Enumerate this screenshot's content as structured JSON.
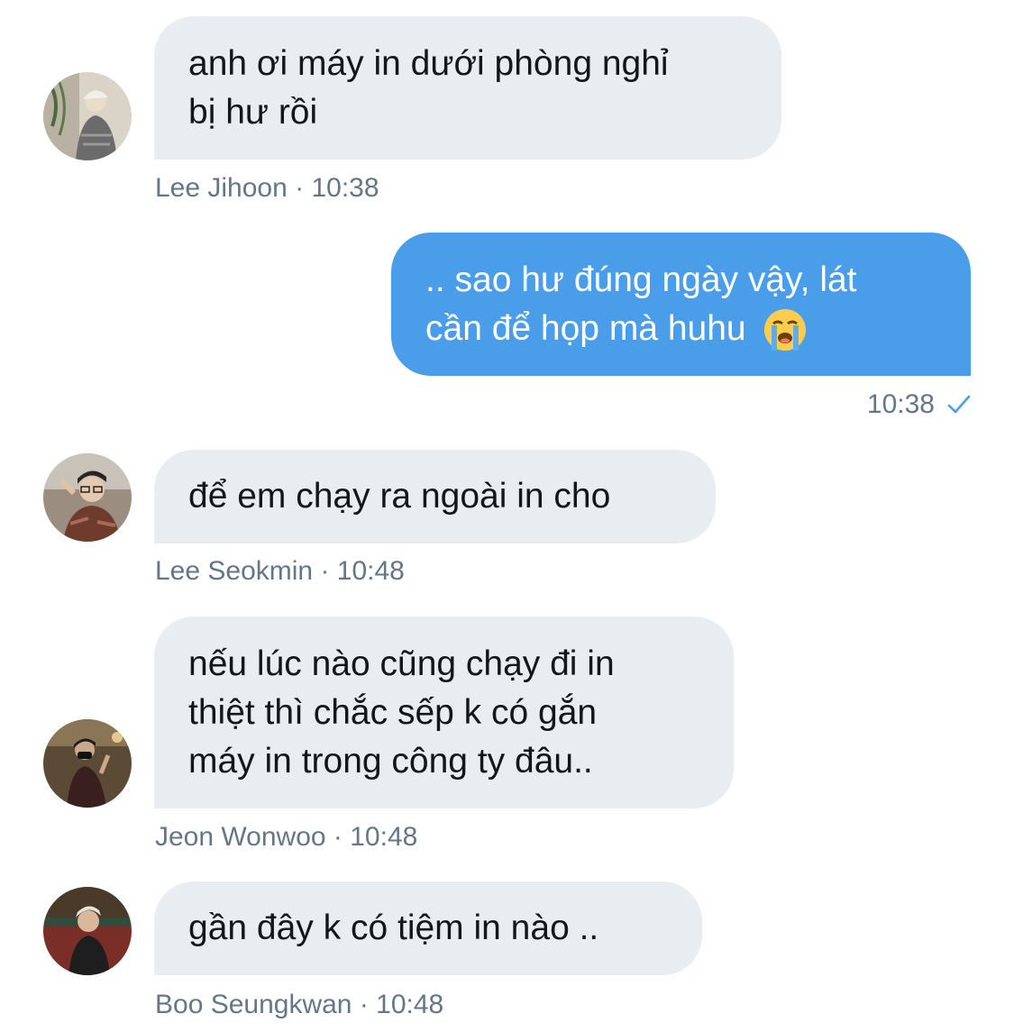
{
  "messages": [
    {
      "direction": "incoming",
      "avatar_icon": "user-avatar-jihoon",
      "text": "anh ơi máy in dưới phòng nghỉ\nbị hư rồi",
      "sender": "Lee Jihoon",
      "time": "10:38"
    },
    {
      "direction": "outgoing",
      "line1": ".. sao hư đúng ngày vậy, lát",
      "line2": "cần để họp mà huhu",
      "emoji_icon": "loudly-crying-face-icon",
      "time": "10:38",
      "status_icon": "read-check-icon"
    },
    {
      "direction": "incoming",
      "avatar_icon": "user-avatar-seokmin",
      "text": "để em chạy ra ngoài in cho",
      "sender": "Lee Seokmin",
      "time": "10:48"
    },
    {
      "direction": "incoming",
      "avatar_icon": "user-avatar-wonwoo",
      "text": "nếu lúc nào cũng chạy đi in\nthiệt thì chắc sếp k có gắn\nmáy in trong công ty đâu..",
      "sender": "Jeon Wonwoo",
      "time": "10:48"
    },
    {
      "direction": "incoming",
      "avatar_icon": "user-avatar-seungkwan",
      "text": "gần đây k có tiệm in nào ..",
      "sender": "Boo Seungkwan",
      "time": "10:48"
    }
  ],
  "meta_separator": " · ",
  "colors": {
    "incoming_bubble": "#e8edf1",
    "outgoing_bubble": "#4a9ee9",
    "meta_text": "#657786",
    "check": "#4a9ee9"
  }
}
